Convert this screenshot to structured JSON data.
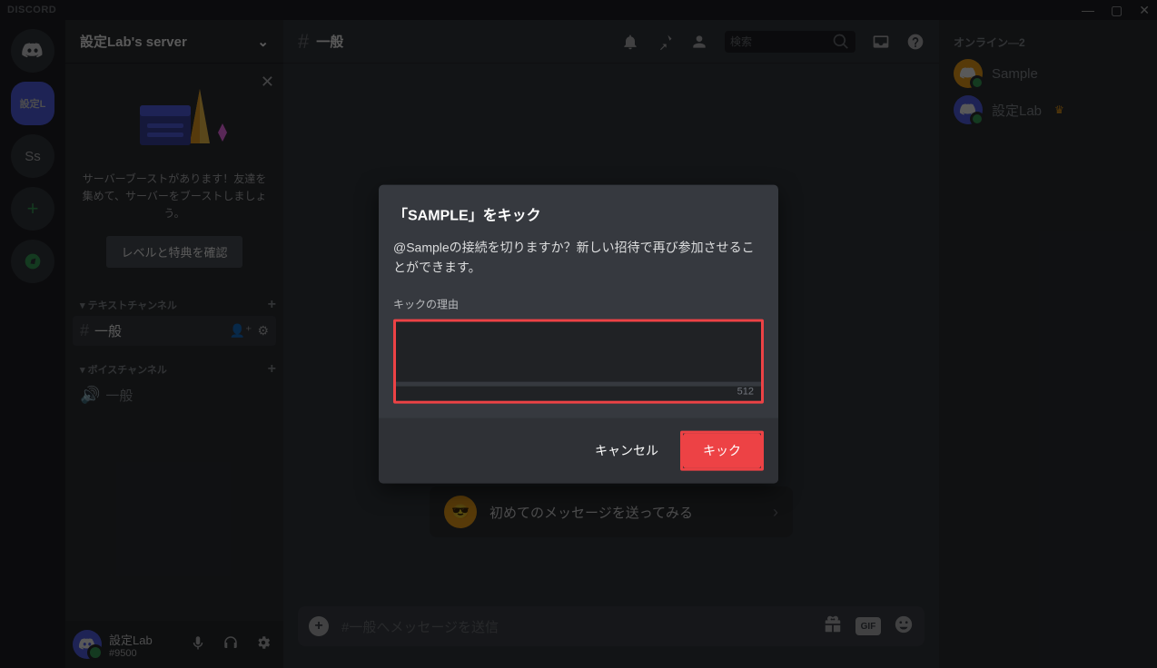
{
  "app": {
    "brand": "DISCORD"
  },
  "server": {
    "name": "設定Lab's server"
  },
  "boost": {
    "text": "サーバーブーストがあります！友達を集めて、サーバーをブーストしましょう。",
    "button": "レベルと特典を確認"
  },
  "categories": {
    "text": {
      "label": "テキストチャンネル"
    },
    "voice": {
      "label": "ボイスチャンネル"
    }
  },
  "channels": {
    "text1": "一般",
    "voice1": "一般"
  },
  "user": {
    "name": "設定Lab",
    "tag": "#9500"
  },
  "header": {
    "channel": "一般",
    "search_placeholder": "検索"
  },
  "quickcard": {
    "text": "初めてのメッセージを送ってみる"
  },
  "compose": {
    "placeholder": "#一般へメッセージを送信"
  },
  "members": {
    "header": "オンライン—2",
    "list": [
      {
        "name": "Sample",
        "color": "#faa61a",
        "owner": false
      },
      {
        "name": "設定Lab",
        "color": "#5865f2",
        "owner": true
      }
    ]
  },
  "modal": {
    "title": "「SAMPLE」をキック",
    "desc": "@Sampleの接続を切りますか？新しい招待で再び参加させることができます。",
    "reason_label": "キックの理由",
    "char_limit": "512",
    "cancel": "キャンセル",
    "confirm": "キック"
  }
}
